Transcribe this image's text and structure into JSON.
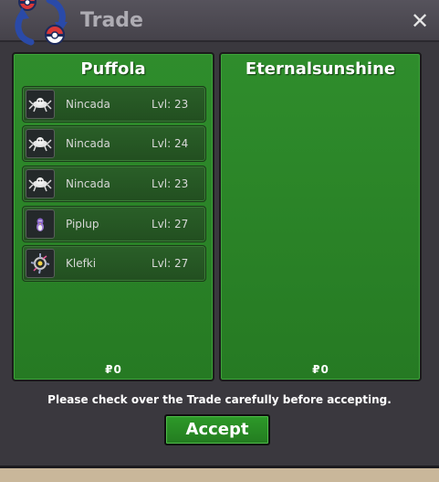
{
  "window": {
    "title": "Trade",
    "close_icon": "close-icon"
  },
  "left_panel": {
    "trader": "Puffola",
    "money": "0",
    "money_icon": "₽",
    "slots": [
      {
        "name": "Nincada",
        "level": "Lvl: 23",
        "icon": "nincada-sprite-icon"
      },
      {
        "name": "Nincada",
        "level": "Lvl: 24",
        "icon": "nincada-sprite-icon"
      },
      {
        "name": "Nincada",
        "level": "Lvl: 23",
        "icon": "nincada-sprite-icon"
      },
      {
        "name": "Piplup",
        "level": "Lvl: 27",
        "icon": "piplup-sprite-icon"
      },
      {
        "name": "Klefki",
        "level": "Lvl: 27",
        "icon": "klefki-sprite-icon"
      }
    ]
  },
  "right_panel": {
    "trader": "Eternalsunshine",
    "money": "0",
    "money_icon": "₽",
    "slots": []
  },
  "footer": {
    "notice": "Please check over the Trade carefully before accepting.",
    "accept_label": "Accept"
  },
  "colors": {
    "panel_green": "#2f8d2c",
    "window_bg": "#3a383e",
    "accept_green": "#2d9a29"
  }
}
